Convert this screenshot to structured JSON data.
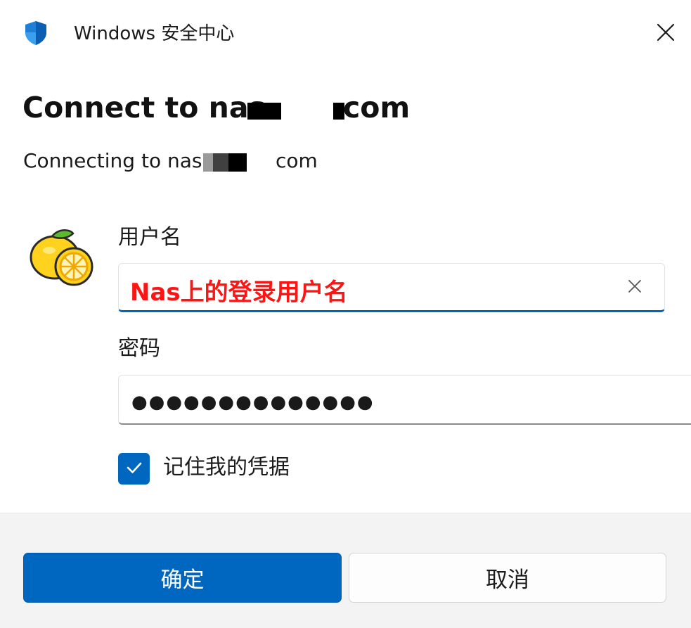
{
  "window": {
    "app_title": "Windows 安全中心",
    "close_icon": "close-icon",
    "app_icon": "shield-icon"
  },
  "dialog": {
    "heading_prefix": "Connect to nas",
    "heading_suffix": "com",
    "subheading_prefix": "Connecting to nas.",
    "subheading_suffix": "com"
  },
  "form": {
    "avatar_icon": "lemon-avatar-icon",
    "username_label": "用户名",
    "username_value": "Nas上的登录用户名",
    "clear_icon": "clear-icon",
    "password_label": "密码",
    "password_value": "●●●●●●●●●●●●●●",
    "remember_checked": true,
    "remember_label": "记住我的凭据"
  },
  "buttons": {
    "ok_label": "确定",
    "cancel_label": "取消"
  },
  "colors": {
    "accent": "#0067c0",
    "annotation_red": "#ff1414",
    "footer_bg": "#f3f3f3"
  }
}
